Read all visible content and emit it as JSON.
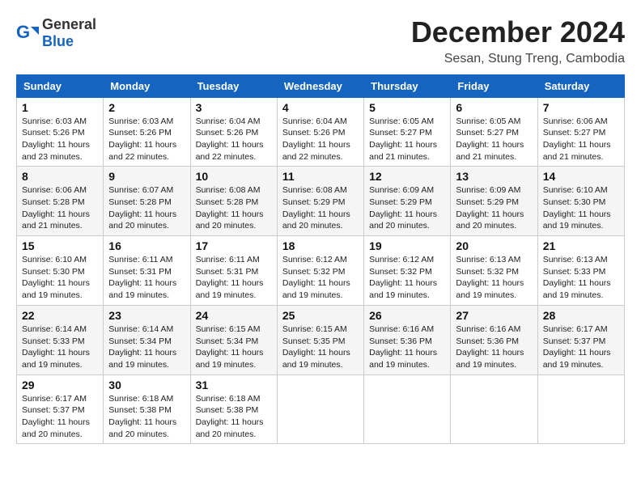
{
  "logo": {
    "general": "General",
    "blue": "Blue"
  },
  "header": {
    "month": "December 2024",
    "location": "Sesan, Stung Treng, Cambodia"
  },
  "weekdays": [
    "Sunday",
    "Monday",
    "Tuesday",
    "Wednesday",
    "Thursday",
    "Friday",
    "Saturday"
  ],
  "weeks": [
    [
      {
        "day": 1,
        "sunrise": "6:03 AM",
        "sunset": "5:26 PM",
        "daylight": "11 hours and 23 minutes."
      },
      {
        "day": 2,
        "sunrise": "6:03 AM",
        "sunset": "5:26 PM",
        "daylight": "11 hours and 22 minutes."
      },
      {
        "day": 3,
        "sunrise": "6:04 AM",
        "sunset": "5:26 PM",
        "daylight": "11 hours and 22 minutes."
      },
      {
        "day": 4,
        "sunrise": "6:04 AM",
        "sunset": "5:26 PM",
        "daylight": "11 hours and 22 minutes."
      },
      {
        "day": 5,
        "sunrise": "6:05 AM",
        "sunset": "5:27 PM",
        "daylight": "11 hours and 21 minutes."
      },
      {
        "day": 6,
        "sunrise": "6:05 AM",
        "sunset": "5:27 PM",
        "daylight": "11 hours and 21 minutes."
      },
      {
        "day": 7,
        "sunrise": "6:06 AM",
        "sunset": "5:27 PM",
        "daylight": "11 hours and 21 minutes."
      }
    ],
    [
      {
        "day": 8,
        "sunrise": "6:06 AM",
        "sunset": "5:28 PM",
        "daylight": "11 hours and 21 minutes."
      },
      {
        "day": 9,
        "sunrise": "6:07 AM",
        "sunset": "5:28 PM",
        "daylight": "11 hours and 20 minutes."
      },
      {
        "day": 10,
        "sunrise": "6:08 AM",
        "sunset": "5:28 PM",
        "daylight": "11 hours and 20 minutes."
      },
      {
        "day": 11,
        "sunrise": "6:08 AM",
        "sunset": "5:29 PM",
        "daylight": "11 hours and 20 minutes."
      },
      {
        "day": 12,
        "sunrise": "6:09 AM",
        "sunset": "5:29 PM",
        "daylight": "11 hours and 20 minutes."
      },
      {
        "day": 13,
        "sunrise": "6:09 AM",
        "sunset": "5:29 PM",
        "daylight": "11 hours and 20 minutes."
      },
      {
        "day": 14,
        "sunrise": "6:10 AM",
        "sunset": "5:30 PM",
        "daylight": "11 hours and 19 minutes."
      }
    ],
    [
      {
        "day": 15,
        "sunrise": "6:10 AM",
        "sunset": "5:30 PM",
        "daylight": "11 hours and 19 minutes."
      },
      {
        "day": 16,
        "sunrise": "6:11 AM",
        "sunset": "5:31 PM",
        "daylight": "11 hours and 19 minutes."
      },
      {
        "day": 17,
        "sunrise": "6:11 AM",
        "sunset": "5:31 PM",
        "daylight": "11 hours and 19 minutes."
      },
      {
        "day": 18,
        "sunrise": "6:12 AM",
        "sunset": "5:32 PM",
        "daylight": "11 hours and 19 minutes."
      },
      {
        "day": 19,
        "sunrise": "6:12 AM",
        "sunset": "5:32 PM",
        "daylight": "11 hours and 19 minutes."
      },
      {
        "day": 20,
        "sunrise": "6:13 AM",
        "sunset": "5:32 PM",
        "daylight": "11 hours and 19 minutes."
      },
      {
        "day": 21,
        "sunrise": "6:13 AM",
        "sunset": "5:33 PM",
        "daylight": "11 hours and 19 minutes."
      }
    ],
    [
      {
        "day": 22,
        "sunrise": "6:14 AM",
        "sunset": "5:33 PM",
        "daylight": "11 hours and 19 minutes."
      },
      {
        "day": 23,
        "sunrise": "6:14 AM",
        "sunset": "5:34 PM",
        "daylight": "11 hours and 19 minutes."
      },
      {
        "day": 24,
        "sunrise": "6:15 AM",
        "sunset": "5:34 PM",
        "daylight": "11 hours and 19 minutes."
      },
      {
        "day": 25,
        "sunrise": "6:15 AM",
        "sunset": "5:35 PM",
        "daylight": "11 hours and 19 minutes."
      },
      {
        "day": 26,
        "sunrise": "6:16 AM",
        "sunset": "5:36 PM",
        "daylight": "11 hours and 19 minutes."
      },
      {
        "day": 27,
        "sunrise": "6:16 AM",
        "sunset": "5:36 PM",
        "daylight": "11 hours and 19 minutes."
      },
      {
        "day": 28,
        "sunrise": "6:17 AM",
        "sunset": "5:37 PM",
        "daylight": "11 hours and 19 minutes."
      }
    ],
    [
      {
        "day": 29,
        "sunrise": "6:17 AM",
        "sunset": "5:37 PM",
        "daylight": "11 hours and 20 minutes."
      },
      {
        "day": 30,
        "sunrise": "6:18 AM",
        "sunset": "5:38 PM",
        "daylight": "11 hours and 20 minutes."
      },
      {
        "day": 31,
        "sunrise": "6:18 AM",
        "sunset": "5:38 PM",
        "daylight": "11 hours and 20 minutes."
      },
      null,
      null,
      null,
      null
    ]
  ],
  "labels": {
    "sunrise": "Sunrise:",
    "sunset": "Sunset:",
    "daylight": "Daylight:"
  }
}
